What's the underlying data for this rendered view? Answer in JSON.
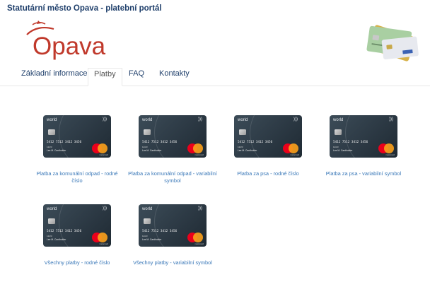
{
  "header": {
    "portal_title": "Statutární město Opava - platební portál",
    "logo_text": "Opava"
  },
  "tabs": [
    {
      "label": "Základní informace"
    },
    {
      "label": "Platby",
      "active": true
    },
    {
      "label": "FAQ"
    },
    {
      "label": "Kontakty"
    }
  ],
  "card": {
    "brand": "world",
    "nfc": ")))",
    "number": "5412 7512 3412 3456",
    "expiry": "12/23",
    "holder": "Lee M. Cardholder",
    "network": "mastercard"
  },
  "payments": [
    {
      "label": "Platba za komunální odpad - rodné číslo"
    },
    {
      "label": "Platba za komunální odpad - variabilní symbol"
    },
    {
      "label": "Platba za psa - rodné číslo"
    },
    {
      "label": "Platba za psa - variabilní symbol"
    },
    {
      "label": "Všechny platby - rodné číslo"
    },
    {
      "label": "Všechny platby - variabilní symbol"
    }
  ],
  "colors": {
    "title": "#1f3f6b",
    "link": "#3a78b8",
    "logo_red": "#c0392b",
    "card_dark": "#2c3944"
  }
}
